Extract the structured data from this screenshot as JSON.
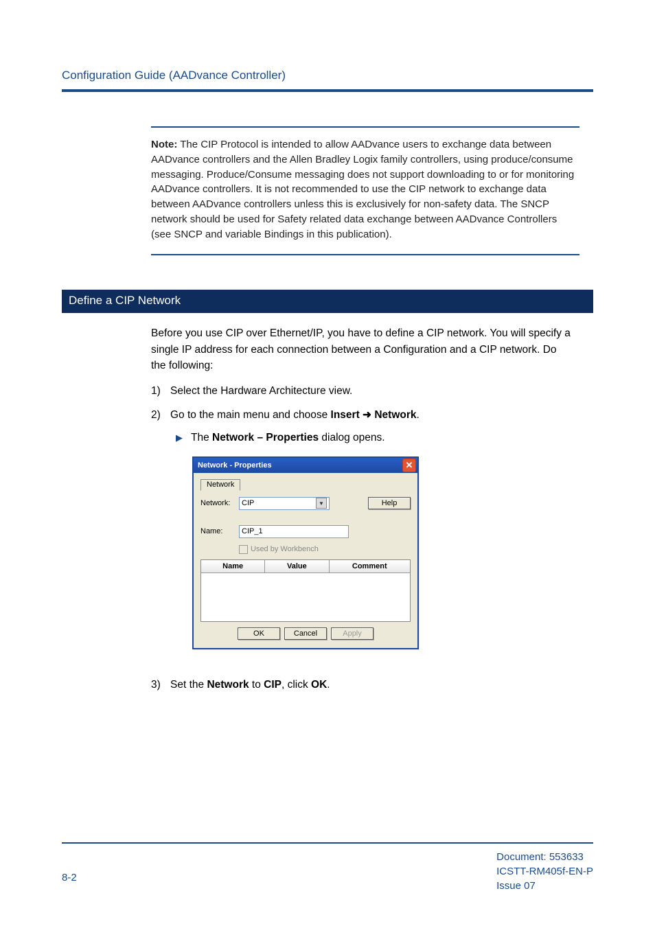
{
  "header": {
    "title": "Configuration Guide (AADvance Controller)"
  },
  "note": {
    "label": "Note:",
    "text": " The CIP Protocol is intended to allow AADvance users to exchange data between AADvance controllers and the Allen Bradley Logix family controllers, using produce/consume messaging. Produce/Consume messaging does not support downloading to or for monitoring AADvance controllers. It is not recommended to use the CIP network to exchange data between  AADvance controllers unless this is exclusively for non-safety data. The SNCP network should be used for Safety related data exchange between AADvance Controllers (see SNCP and variable Bindings in this publication)."
  },
  "section": {
    "title": "Define a CIP Network",
    "intro": "Before you use CIP over Ethernet/IP, you have to define a CIP network. You will specify a single IP address for each connection between a Configuration and a CIP network. Do the following:",
    "step1_num": "1)",
    "step1_text": "Select the Hardware Architecture view.",
    "step2_num": "2)",
    "step2_pre": "Go to the main menu and choose ",
    "step2_insert": "Insert",
    "step2_arrow": " ➜ ",
    "step2_network": "Network",
    "step2_post": ".",
    "bullet_pre": "The ",
    "bullet_bold": "Network – Properties",
    "bullet_post": " dialog opens.",
    "step3_num": "3)",
    "step3_a": "Set the ",
    "step3_b": "Network",
    "step3_c": " to ",
    "step3_d": "CIP",
    "step3_e": ", click ",
    "step3_f": "OK",
    "step3_g": "."
  },
  "dialog": {
    "title": "Network - Properties",
    "tab": "Network",
    "network_label": "Network:",
    "network_value": "CIP",
    "help": "Help",
    "name_label": "Name:",
    "name_value": "CIP_1",
    "used_by": "Used by Workbench",
    "col_name": "Name",
    "col_value": "Value",
    "col_comment": "Comment",
    "ok": "OK",
    "cancel": "Cancel",
    "apply": "Apply"
  },
  "footer": {
    "page": "8-2",
    "doc": "Document: 553633",
    "part": "ICSTT-RM405f-EN-P",
    "issue": "Issue 07"
  }
}
